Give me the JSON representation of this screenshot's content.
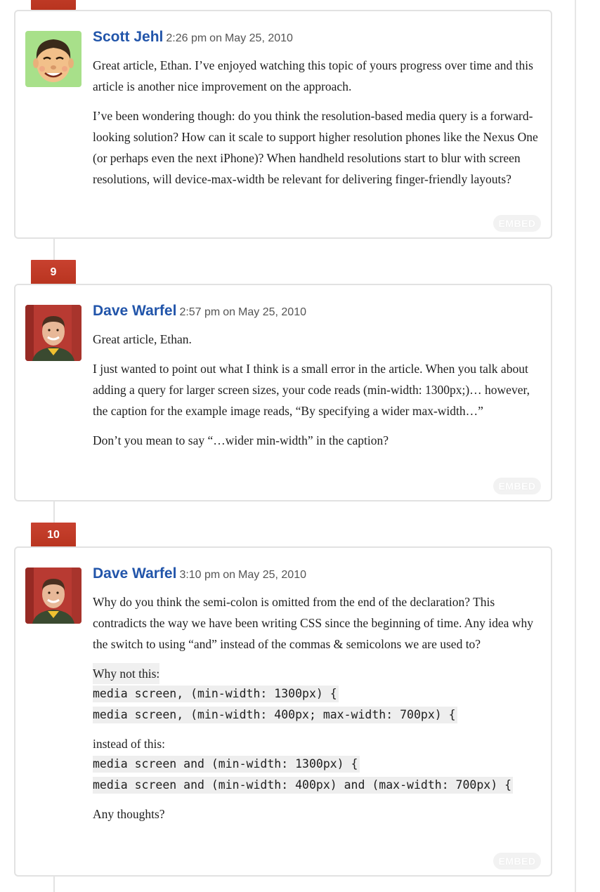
{
  "colors": {
    "badge": "#c0392b",
    "author_link": "#2255aa",
    "border": "#e2e2e2",
    "code_bg": "#eeeeee"
  },
  "comments": [
    {
      "number": "",
      "author": "Scott Jehl",
      "time": "2:26 pm",
      "date_prefix": "on",
      "date": "May 25, 2010",
      "paragraphs": [
        "Great article, Ethan. I’ve enjoyed watching this topic of yours progress over time and this article is another nice improvement on the approach.",
        "I’ve been wondering though: do you think the resolution-based media query is a forward-looking solution? How can it scale to support higher resolution phones like the Nexus One (or perhaps even the next iPhone)? When handheld resolutions start to blur with screen resolutions, will device-max-width be relevant for delivering finger-friendly layouts?"
      ],
      "embed_label": "EMBED"
    },
    {
      "number": "9",
      "author": "Dave Warfel",
      "time": "2:57 pm",
      "date_prefix": "on",
      "date": "May 25, 2010",
      "paragraphs": [
        "Great article, Ethan.",
        "I just wanted to point out what I think is a small error in the article. When you talk about adding a query for larger screen sizes, your code reads (min-width: 1300px;)… however, the caption for the example image reads, “By specifying a wider max-width…”",
        "Don’t you mean to say “…wider min-width” in the caption?"
      ],
      "embed_label": "EMBED"
    },
    {
      "number": "10",
      "author": "Dave Warfel",
      "time": "3:10 pm",
      "date_prefix": "on",
      "date": "May 25, 2010",
      "paragraphs": [
        "Why do you think the semi-colon is omitted from the end of the declaration? This contradicts the way we have been writing CSS since the beginning of time. Any idea why the switch to using “and” instead of the commas & semicolons we are used to?"
      ],
      "code_blocks": [
        {
          "lead": "Why not this:",
          "lines": [
            "media screen, (min-width: 1300px) {",
            "media screen, (min-width: 400px; max-width: 700px) {"
          ]
        },
        {
          "lead": "instead of this:",
          "lines": [
            "media screen and (min-width: 1300px) {",
            "media screen and (min-width: 400px) and (max-width: 700px) {"
          ]
        }
      ],
      "closing": "Any thoughts?",
      "embed_label": "EMBED"
    }
  ]
}
